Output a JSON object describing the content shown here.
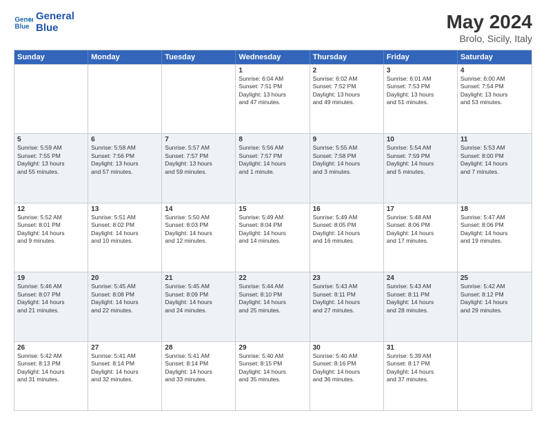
{
  "logo": {
    "line1": "General",
    "line2": "Blue"
  },
  "title": "May 2024",
  "subtitle": "Brolo, Sicily, Italy",
  "weekdays": [
    "Sunday",
    "Monday",
    "Tuesday",
    "Wednesday",
    "Thursday",
    "Friday",
    "Saturday"
  ],
  "rows": [
    [
      {
        "day": "",
        "info": ""
      },
      {
        "day": "",
        "info": ""
      },
      {
        "day": "",
        "info": ""
      },
      {
        "day": "1",
        "info": "Sunrise: 6:04 AM\nSunset: 7:51 PM\nDaylight: 13 hours\nand 47 minutes."
      },
      {
        "day": "2",
        "info": "Sunrise: 6:02 AM\nSunset: 7:52 PM\nDaylight: 13 hours\nand 49 minutes."
      },
      {
        "day": "3",
        "info": "Sunrise: 6:01 AM\nSunset: 7:53 PM\nDaylight: 13 hours\nand 51 minutes."
      },
      {
        "day": "4",
        "info": "Sunrise: 6:00 AM\nSunset: 7:54 PM\nDaylight: 13 hours\nand 53 minutes."
      }
    ],
    [
      {
        "day": "5",
        "info": "Sunrise: 5:59 AM\nSunset: 7:55 PM\nDaylight: 13 hours\nand 55 minutes."
      },
      {
        "day": "6",
        "info": "Sunrise: 5:58 AM\nSunset: 7:56 PM\nDaylight: 13 hours\nand 57 minutes."
      },
      {
        "day": "7",
        "info": "Sunrise: 5:57 AM\nSunset: 7:57 PM\nDaylight: 13 hours\nand 59 minutes."
      },
      {
        "day": "8",
        "info": "Sunrise: 5:56 AM\nSunset: 7:57 PM\nDaylight: 14 hours\nand 1 minute."
      },
      {
        "day": "9",
        "info": "Sunrise: 5:55 AM\nSunset: 7:58 PM\nDaylight: 14 hours\nand 3 minutes."
      },
      {
        "day": "10",
        "info": "Sunrise: 5:54 AM\nSunset: 7:59 PM\nDaylight: 14 hours\nand 5 minutes."
      },
      {
        "day": "11",
        "info": "Sunrise: 5:53 AM\nSunset: 8:00 PM\nDaylight: 14 hours\nand 7 minutes."
      }
    ],
    [
      {
        "day": "12",
        "info": "Sunrise: 5:52 AM\nSunset: 8:01 PM\nDaylight: 14 hours\nand 9 minutes."
      },
      {
        "day": "13",
        "info": "Sunrise: 5:51 AM\nSunset: 8:02 PM\nDaylight: 14 hours\nand 10 minutes."
      },
      {
        "day": "14",
        "info": "Sunrise: 5:50 AM\nSunset: 8:03 PM\nDaylight: 14 hours\nand 12 minutes."
      },
      {
        "day": "15",
        "info": "Sunrise: 5:49 AM\nSunset: 8:04 PM\nDaylight: 14 hours\nand 14 minutes."
      },
      {
        "day": "16",
        "info": "Sunrise: 5:49 AM\nSunset: 8:05 PM\nDaylight: 14 hours\nand 16 minutes."
      },
      {
        "day": "17",
        "info": "Sunrise: 5:48 AM\nSunset: 8:06 PM\nDaylight: 14 hours\nand 17 minutes."
      },
      {
        "day": "18",
        "info": "Sunrise: 5:47 AM\nSunset: 8:06 PM\nDaylight: 14 hours\nand 19 minutes."
      }
    ],
    [
      {
        "day": "19",
        "info": "Sunrise: 5:46 AM\nSunset: 8:07 PM\nDaylight: 14 hours\nand 21 minutes."
      },
      {
        "day": "20",
        "info": "Sunrise: 5:45 AM\nSunset: 8:08 PM\nDaylight: 14 hours\nand 22 minutes."
      },
      {
        "day": "21",
        "info": "Sunrise: 5:45 AM\nSunset: 8:09 PM\nDaylight: 14 hours\nand 24 minutes."
      },
      {
        "day": "22",
        "info": "Sunrise: 5:44 AM\nSunset: 8:10 PM\nDaylight: 14 hours\nand 25 minutes."
      },
      {
        "day": "23",
        "info": "Sunrise: 5:43 AM\nSunset: 8:11 PM\nDaylight: 14 hours\nand 27 minutes."
      },
      {
        "day": "24",
        "info": "Sunrise: 5:43 AM\nSunset: 8:11 PM\nDaylight: 14 hours\nand 28 minutes."
      },
      {
        "day": "25",
        "info": "Sunrise: 5:42 AM\nSunset: 8:12 PM\nDaylight: 14 hours\nand 29 minutes."
      }
    ],
    [
      {
        "day": "26",
        "info": "Sunrise: 5:42 AM\nSunset: 8:13 PM\nDaylight: 14 hours\nand 31 minutes."
      },
      {
        "day": "27",
        "info": "Sunrise: 5:41 AM\nSunset: 8:14 PM\nDaylight: 14 hours\nand 32 minutes."
      },
      {
        "day": "28",
        "info": "Sunrise: 5:41 AM\nSunset: 8:14 PM\nDaylight: 14 hours\nand 33 minutes."
      },
      {
        "day": "29",
        "info": "Sunrise: 5:40 AM\nSunset: 8:15 PM\nDaylight: 14 hours\nand 35 minutes."
      },
      {
        "day": "30",
        "info": "Sunrise: 5:40 AM\nSunset: 8:16 PM\nDaylight: 14 hours\nand 36 minutes."
      },
      {
        "day": "31",
        "info": "Sunrise: 5:39 AM\nSunset: 8:17 PM\nDaylight: 14 hours\nand 37 minutes."
      },
      {
        "day": "",
        "info": ""
      }
    ]
  ]
}
